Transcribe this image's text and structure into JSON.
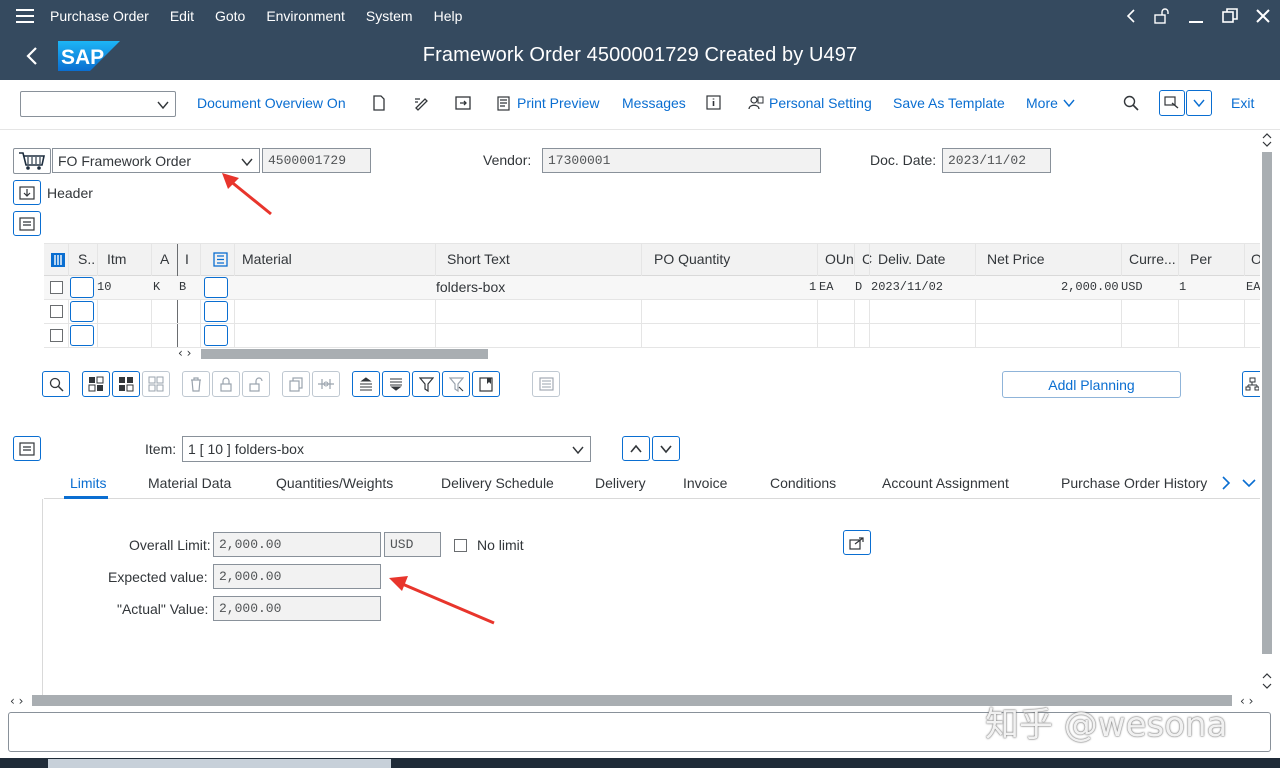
{
  "menubar": {
    "items": [
      "Purchase Order",
      "Edit",
      "Goto",
      "Environment",
      "System",
      "Help"
    ]
  },
  "titlebar": {
    "logo_text": "SAP",
    "title": "Framework Order 4500001729 Created by U497"
  },
  "toolbar": {
    "document_overview": "Document Overview On",
    "print_preview": "Print Preview",
    "messages": "Messages",
    "personal_setting": "Personal Setting",
    "save_as_template": "Save As Template",
    "more": "More",
    "exit": "Exit"
  },
  "header": {
    "order_type": "FO Framework Order",
    "po_number": "4500001729",
    "vendor_label": "Vendor:",
    "vendor": "17300001",
    "doc_date_label": "Doc. Date:",
    "doc_date": "2023/11/02",
    "header_label": "Header"
  },
  "items_table": {
    "columns": [
      "S..",
      "Itm",
      "A",
      "I",
      "Material",
      "Short Text",
      "PO Quantity",
      "OUn",
      "C",
      "Deliv. Date",
      "Net Price",
      "Curre...",
      "Per",
      "O"
    ],
    "rows": [
      {
        "itm": "10",
        "a": "K",
        "i": "B",
        "material": "",
        "short_text": "folders-box",
        "po_qty": "1",
        "oun": "EA",
        "c": "D",
        "deliv_date": "2023/11/02",
        "net_price": "2,000.00",
        "curr": "USD",
        "per": "1",
        "o": "EA"
      }
    ]
  },
  "table_toolbar": {
    "addl_planning": "Addl Planning"
  },
  "item_detail": {
    "item_label": "Item:",
    "item_value": "1 [ 10 ] folders-box",
    "tabs": [
      "Limits",
      "Material Data",
      "Quantities/Weights",
      "Delivery Schedule",
      "Delivery",
      "Invoice",
      "Conditions",
      "Account Assignment",
      "Purchase Order History"
    ],
    "active_tab": "Limits",
    "overall_limit_label": "Overall Limit:",
    "overall_limit": "2,000.00",
    "currency": "USD",
    "no_limit_label": "No limit",
    "expected_value_label": "Expected value:",
    "expected_value": "2,000.00",
    "actual_value_label": "\"Actual\" Value:",
    "actual_value": "2,000.00"
  },
  "watermark": "知乎 @wesona",
  "colors": {
    "shell": "#354a5f",
    "accent": "#0a6ed1",
    "annotation_arrow": "#e8352c"
  }
}
